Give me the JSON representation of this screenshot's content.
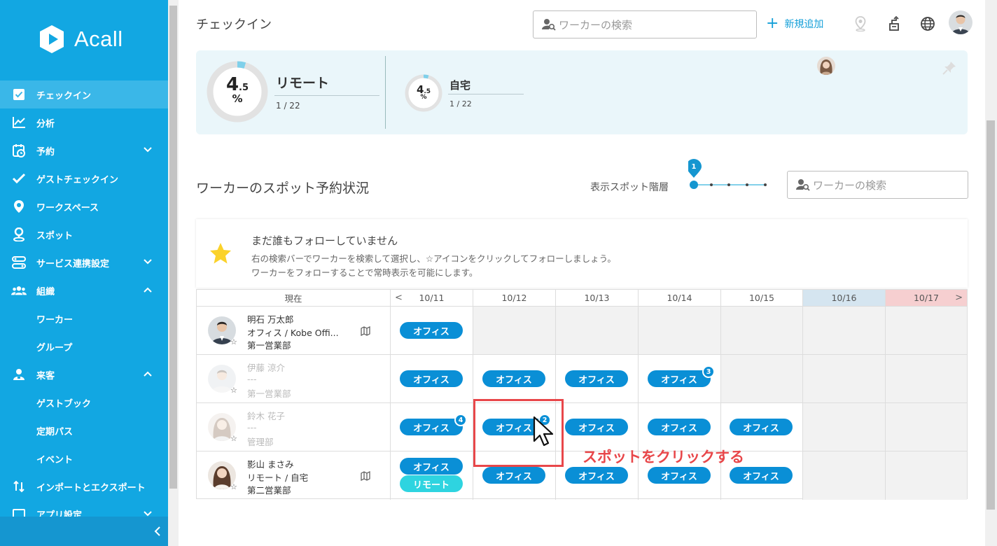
{
  "app": {
    "logo_text": "Acall"
  },
  "sidebar": {
    "items": [
      {
        "label": "チェックイン",
        "icon": "checkbox-icon",
        "active": true
      },
      {
        "label": "分析",
        "icon": "chart-icon"
      },
      {
        "label": "予約",
        "icon": "calendar-clock-icon",
        "chevron": "down"
      },
      {
        "label": "ゲストチェックイン",
        "icon": "check-icon"
      },
      {
        "label": "ワークスペース",
        "icon": "map-pin-icon"
      },
      {
        "label": "スポット",
        "icon": "person-pin-icon"
      },
      {
        "label": "サービス連携設定",
        "icon": "integration-icon",
        "chevron": "down"
      },
      {
        "label": "組織",
        "icon": "group-icon",
        "chevron": "up"
      },
      {
        "label": "ワーカー",
        "sub": true
      },
      {
        "label": "グループ",
        "sub": true
      },
      {
        "label": "来客",
        "icon": "visitor-icon",
        "chevron": "up"
      },
      {
        "label": "ゲストブック",
        "sub": true
      },
      {
        "label": "定期パス",
        "sub": true
      },
      {
        "label": "イベント",
        "sub": true
      },
      {
        "label": "インポートとエクスポート",
        "icon": "import-export-icon"
      },
      {
        "label": "アプリ設定",
        "icon": "app-settings-icon",
        "chevron": "down"
      }
    ]
  },
  "header": {
    "title": "チェックイン",
    "search_placeholder": "ワーカーの検索",
    "new_add_label": "新規追加"
  },
  "stats": {
    "remote": {
      "value": "4",
      "decimal": ".5",
      "unit": "%",
      "label": "リモート",
      "count": "1 / 22",
      "fraction": 0.045
    },
    "home": {
      "value": "4",
      "decimal": ".5",
      "unit": "%",
      "label": "自宅",
      "count": "1 / 22",
      "fraction": 0.045
    }
  },
  "section": {
    "title": "ワーカーのスポット予約状況",
    "hierarchy_label": "表示スポット階層",
    "hierarchy_level": "1",
    "search_placeholder": "ワーカーの検索"
  },
  "notice": {
    "title": "まだ誰もフォローしていません",
    "line1": "右の検索バーでワーカーを検索して選択し、☆アイコンをクリックしてフォローしましょう。",
    "line2": "ワーカーをフォローすることで常時表示を可能にします。"
  },
  "table": {
    "current_header": "現在",
    "prev_arrow": "<",
    "next_arrow": ">",
    "dates": [
      "10/11",
      "10/12",
      "10/13",
      "10/14",
      "10/15",
      "10/16",
      "10/17"
    ],
    "workers": [
      {
        "name": "明石 万太郎",
        "location": "オフィス / Kobe Offi...",
        "dept": "第一営業部",
        "dimmed": false,
        "has_map": true
      },
      {
        "name": "伊藤 涼介",
        "location": "---",
        "dept": "第一営業部",
        "dimmed": true,
        "has_map": false
      },
      {
        "name": "鈴木 花子",
        "location": "---",
        "dept": "管理部",
        "dimmed": true,
        "has_map": false
      },
      {
        "name": "影山 まさみ",
        "location": "リモート / 自宅",
        "dept": "第二営業部",
        "dimmed": false,
        "has_map": true
      }
    ],
    "spot_label": "オフィス",
    "remote_label": "リモート",
    "badges": {
      "r1_d4": "3",
      "r2_d1": "4",
      "r2_d2": "2"
    }
  },
  "annotation": {
    "callout": "スポットをクリックする"
  },
  "colors": {
    "sidebar": "#12a7e2",
    "accent": "#0a8fd6",
    "remote_pill": "#2ed4e0",
    "highlight": "#e8474a"
  }
}
